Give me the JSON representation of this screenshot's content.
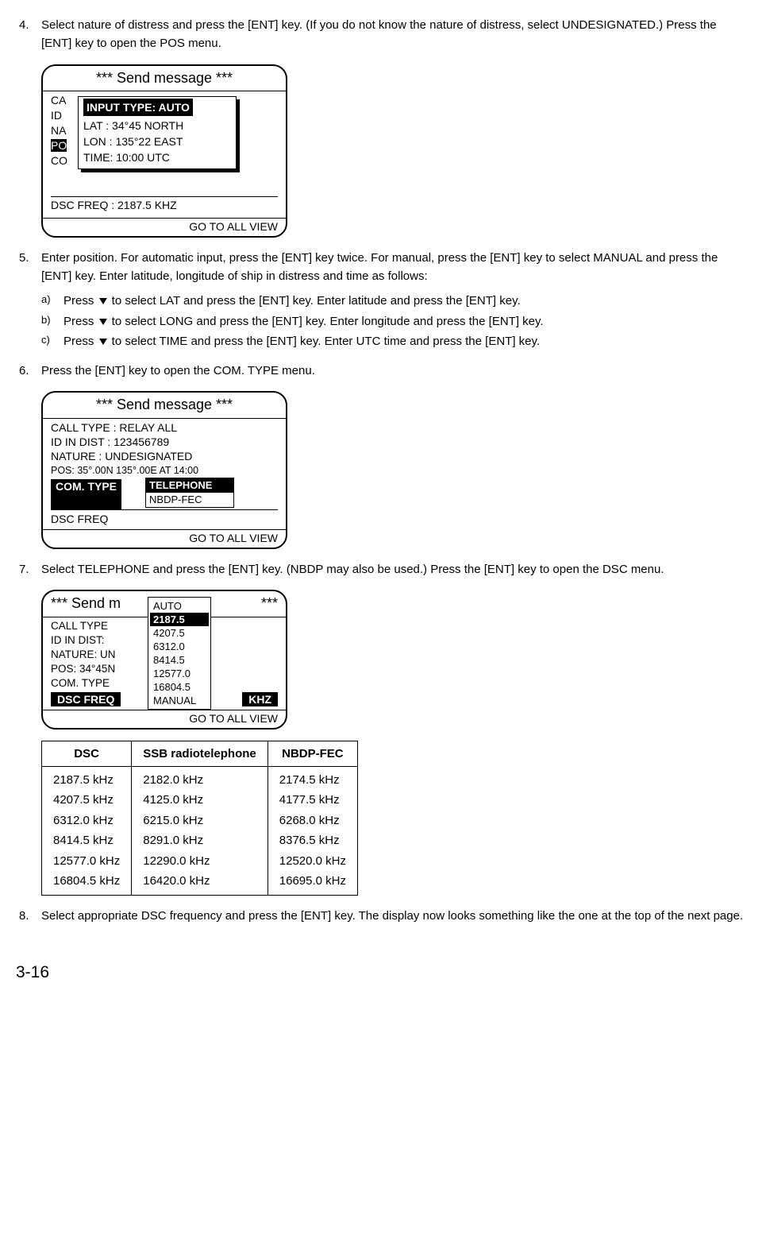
{
  "steps": {
    "4": {
      "num": "4.",
      "text": "Select nature of distress and press the [ENT] key. (If you do not know the nature of distress, select UNDESIGNATED.) Press the [ENT] key to open the POS menu."
    },
    "5": {
      "num": "5.",
      "text": "Enter position. For automatic input, press the [ENT] key twice. For manual, press the [ENT] key to select MANUAL and press the [ENT] key. Enter latitude, longitude of ship in distress and time as follows:",
      "subs": {
        "a": {
          "lbl": "a)",
          "text_before": "Press ",
          "text_after": " to select LAT and press the [ENT] key. Enter latitude and press the [ENT] key."
        },
        "b": {
          "lbl": "b)",
          "text_before": "Press ",
          "text_after": " to select LONG and press the [ENT] key. Enter longitude and press the [ENT] key."
        },
        "c": {
          "lbl": "c)",
          "text_before": "Press ",
          "text_after": " to select TIME and press the [ENT] key. Enter UTC time and press the [ENT] key."
        }
      }
    },
    "6": {
      "num": "6.",
      "text": "Press the [ENT] key to open the COM. TYPE menu."
    },
    "7": {
      "num": "7.",
      "text": "Select TELEPHONE and press the [ENT] key. (NBDP may also be used.) Press the [ENT] key to open the DSC menu."
    },
    "8": {
      "num": "8.",
      "text": "Select appropriate DSC frequency and press the [ENT] key. The display now looks something like the one at the top of the next page."
    }
  },
  "screen_shared": {
    "title": "*** Send message ***",
    "title_alt": "***    Send message    ***",
    "footer": "GO TO ALL VIEW"
  },
  "s1": {
    "rows": {
      "r0": "CA",
      "r1": "ID",
      "r2": "NA",
      "r3": "PO",
      "r4": "CO",
      "r5": "DSC FREQ            :    2187.5 KHZ"
    },
    "popup": {
      "header": "INPUT TYPE: AUTO",
      "l1": "LAT  :    34°45  NORTH",
      "l2": "LON :  135°22  EAST",
      "l3": "TIME:   10:00   UTC"
    }
  },
  "s2": {
    "rows": {
      "r0": "CALL TYPE  : RELAY ALL",
      "r1": "ID IN DIST : 123456789",
      "r2": "NATURE  : UNDESIGNATED",
      "r3": "POS: 35°.00N    135°.00E    AT 14:00",
      "com_label": "COM. TYPE",
      "dsc": "DSC FREQ"
    },
    "popup": {
      "sel": "TELEPHONE",
      "unsel": "NBDP-FEC"
    }
  },
  "s3": {
    "title": "*** Send m",
    "title_tail": "***",
    "rows": {
      "r0": "CALL TYPE",
      "r1": "ID IN DIST:",
      "r2": "NATURE: UN",
      "r3": "POS: 34°45N",
      "r4": "COM. TYPE",
      "dsc_label": "DSC FREQ",
      "khz": "KHZ"
    },
    "popup": {
      "l0": "AUTO",
      "sel": "2187.5",
      "l2": "4207.5",
      "l3": "6312.0",
      "l4": "8414.5",
      "l5": "12577.0",
      "l6": "16804.5",
      "l7": "MANUAL"
    }
  },
  "freq_table": {
    "headers": {
      "c0": "DSC",
      "c1": "SSB radiotelephone",
      "c2": "NBDP-FEC"
    },
    "cols": {
      "dsc": [
        "2187.5 kHz",
        "4207.5 kHz",
        "6312.0 kHz",
        "8414.5 kHz",
        "12577.0 kHz",
        "16804.5 kHz"
      ],
      "ssb": [
        "2182.0 kHz",
        "4125.0 kHz",
        "6215.0 kHz",
        "8291.0 kHz",
        "12290.0 kHz",
        "16420.0 kHz"
      ],
      "nbdp": [
        "2174.5 kHz",
        "4177.5 kHz",
        "6268.0 kHz",
        "8376.5 kHz",
        "12520.0 kHz",
        "16695.0 kHz"
      ]
    }
  },
  "page_number": "3-16"
}
